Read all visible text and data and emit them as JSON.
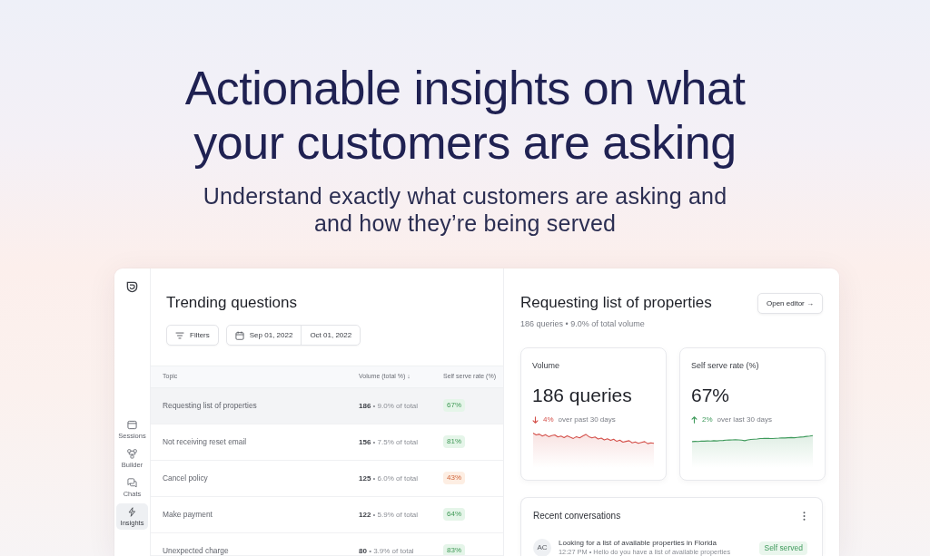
{
  "hero": {
    "title": "Actionable insights on what your customers are asking",
    "subtitle": "Understand exactly what customers are asking and and how they’re being served"
  },
  "sidebar": {
    "items": [
      {
        "label": "Sessions",
        "selected": false
      },
      {
        "label": "Builder",
        "selected": false
      },
      {
        "label": "Chats",
        "selected": false
      },
      {
        "label": "Insights",
        "selected": true
      }
    ]
  },
  "trending": {
    "title": "Trending questions",
    "filters_button": "Filters",
    "date_range": {
      "start": "Sep 01, 2022",
      "end": "Oct 01, 2022"
    },
    "table": {
      "columns": [
        "Topic",
        "Volume (total %) ↓",
        "Self serve rate (%)"
      ],
      "rows": [
        {
          "topic": "Requesting list of properties",
          "volume": "**186** • 9.0% of total",
          "rate": "67%",
          "color": "#e5f5e9",
          "selected": true
        },
        {
          "topic": "Not receiving reset email",
          "volume": "**156** • 7.5% of total",
          "rate": "81%",
          "color": "#e5f5e9",
          "selected": false
        },
        {
          "topic": "Cancel policy",
          "volume": "**125** • 6.0% of total",
          "rate": "43%",
          "color": "#fdeee3",
          "selected": false
        },
        {
          "topic": "Make payment",
          "volume": "**122** • 5.9% of total",
          "rate": "64%",
          "color": "#e5f5e9",
          "selected": false
        },
        {
          "topic": "Unexpected charge",
          "volume": "**80** • 3.9% of total",
          "rate": "83%",
          "color": "#e5f5e9",
          "selected": false
        }
      ]
    }
  },
  "detail": {
    "title": "Requesting list of properties",
    "subtitle": "186 queries • 9.0% of total volume",
    "editor_button": "Open editor →",
    "metrics": [
      {
        "label": "Volume",
        "value": "186 queries",
        "change": "4%",
        "period": "over past 30 days",
        "kind": "decrease"
      },
      {
        "label": "Self serve rate (%)",
        "value": "67%",
        "change": "2%",
        "period": "over last 30 days",
        "kind": "increase"
      }
    ],
    "recent": {
      "title": "Recent conversations",
      "items": [
        {
          "initials": "AC",
          "title": "Looking for a list of available properties in Florida",
          "preview": "12:27 PM • Hello do you have a list of available properties",
          "status": "Self served"
        }
      ]
    }
  }
}
